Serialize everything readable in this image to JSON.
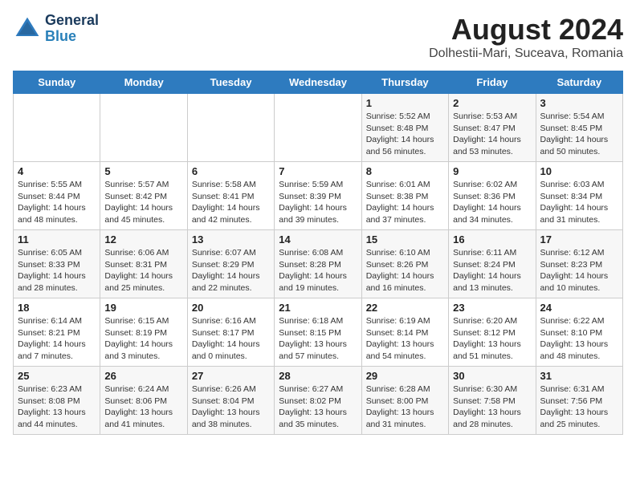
{
  "header": {
    "logo_general": "General",
    "logo_blue": "Blue",
    "title": "August 2024",
    "subtitle": "Dolhestii-Mari, Suceava, Romania"
  },
  "days_of_week": [
    "Sunday",
    "Monday",
    "Tuesday",
    "Wednesday",
    "Thursday",
    "Friday",
    "Saturday"
  ],
  "weeks": [
    [
      {
        "day": "",
        "info": ""
      },
      {
        "day": "",
        "info": ""
      },
      {
        "day": "",
        "info": ""
      },
      {
        "day": "",
        "info": ""
      },
      {
        "day": "1",
        "info": "Sunrise: 5:52 AM\nSunset: 8:48 PM\nDaylight: 14 hours\nand 56 minutes."
      },
      {
        "day": "2",
        "info": "Sunrise: 5:53 AM\nSunset: 8:47 PM\nDaylight: 14 hours\nand 53 minutes."
      },
      {
        "day": "3",
        "info": "Sunrise: 5:54 AM\nSunset: 8:45 PM\nDaylight: 14 hours\nand 50 minutes."
      }
    ],
    [
      {
        "day": "4",
        "info": "Sunrise: 5:55 AM\nSunset: 8:44 PM\nDaylight: 14 hours\nand 48 minutes."
      },
      {
        "day": "5",
        "info": "Sunrise: 5:57 AM\nSunset: 8:42 PM\nDaylight: 14 hours\nand 45 minutes."
      },
      {
        "day": "6",
        "info": "Sunrise: 5:58 AM\nSunset: 8:41 PM\nDaylight: 14 hours\nand 42 minutes."
      },
      {
        "day": "7",
        "info": "Sunrise: 5:59 AM\nSunset: 8:39 PM\nDaylight: 14 hours\nand 39 minutes."
      },
      {
        "day": "8",
        "info": "Sunrise: 6:01 AM\nSunset: 8:38 PM\nDaylight: 14 hours\nand 37 minutes."
      },
      {
        "day": "9",
        "info": "Sunrise: 6:02 AM\nSunset: 8:36 PM\nDaylight: 14 hours\nand 34 minutes."
      },
      {
        "day": "10",
        "info": "Sunrise: 6:03 AM\nSunset: 8:34 PM\nDaylight: 14 hours\nand 31 minutes."
      }
    ],
    [
      {
        "day": "11",
        "info": "Sunrise: 6:05 AM\nSunset: 8:33 PM\nDaylight: 14 hours\nand 28 minutes."
      },
      {
        "day": "12",
        "info": "Sunrise: 6:06 AM\nSunset: 8:31 PM\nDaylight: 14 hours\nand 25 minutes."
      },
      {
        "day": "13",
        "info": "Sunrise: 6:07 AM\nSunset: 8:29 PM\nDaylight: 14 hours\nand 22 minutes."
      },
      {
        "day": "14",
        "info": "Sunrise: 6:08 AM\nSunset: 8:28 PM\nDaylight: 14 hours\nand 19 minutes."
      },
      {
        "day": "15",
        "info": "Sunrise: 6:10 AM\nSunset: 8:26 PM\nDaylight: 14 hours\nand 16 minutes."
      },
      {
        "day": "16",
        "info": "Sunrise: 6:11 AM\nSunset: 8:24 PM\nDaylight: 14 hours\nand 13 minutes."
      },
      {
        "day": "17",
        "info": "Sunrise: 6:12 AM\nSunset: 8:23 PM\nDaylight: 14 hours\nand 10 minutes."
      }
    ],
    [
      {
        "day": "18",
        "info": "Sunrise: 6:14 AM\nSunset: 8:21 PM\nDaylight: 14 hours\nand 7 minutes."
      },
      {
        "day": "19",
        "info": "Sunrise: 6:15 AM\nSunset: 8:19 PM\nDaylight: 14 hours\nand 3 minutes."
      },
      {
        "day": "20",
        "info": "Sunrise: 6:16 AM\nSunset: 8:17 PM\nDaylight: 14 hours\nand 0 minutes."
      },
      {
        "day": "21",
        "info": "Sunrise: 6:18 AM\nSunset: 8:15 PM\nDaylight: 13 hours\nand 57 minutes."
      },
      {
        "day": "22",
        "info": "Sunrise: 6:19 AM\nSunset: 8:14 PM\nDaylight: 13 hours\nand 54 minutes."
      },
      {
        "day": "23",
        "info": "Sunrise: 6:20 AM\nSunset: 8:12 PM\nDaylight: 13 hours\nand 51 minutes."
      },
      {
        "day": "24",
        "info": "Sunrise: 6:22 AM\nSunset: 8:10 PM\nDaylight: 13 hours\nand 48 minutes."
      }
    ],
    [
      {
        "day": "25",
        "info": "Sunrise: 6:23 AM\nSunset: 8:08 PM\nDaylight: 13 hours\nand 44 minutes."
      },
      {
        "day": "26",
        "info": "Sunrise: 6:24 AM\nSunset: 8:06 PM\nDaylight: 13 hours\nand 41 minutes."
      },
      {
        "day": "27",
        "info": "Sunrise: 6:26 AM\nSunset: 8:04 PM\nDaylight: 13 hours\nand 38 minutes."
      },
      {
        "day": "28",
        "info": "Sunrise: 6:27 AM\nSunset: 8:02 PM\nDaylight: 13 hours\nand 35 minutes."
      },
      {
        "day": "29",
        "info": "Sunrise: 6:28 AM\nSunset: 8:00 PM\nDaylight: 13 hours\nand 31 minutes."
      },
      {
        "day": "30",
        "info": "Sunrise: 6:30 AM\nSunset: 7:58 PM\nDaylight: 13 hours\nand 28 minutes."
      },
      {
        "day": "31",
        "info": "Sunrise: 6:31 AM\nSunset: 7:56 PM\nDaylight: 13 hours\nand 25 minutes."
      }
    ]
  ]
}
